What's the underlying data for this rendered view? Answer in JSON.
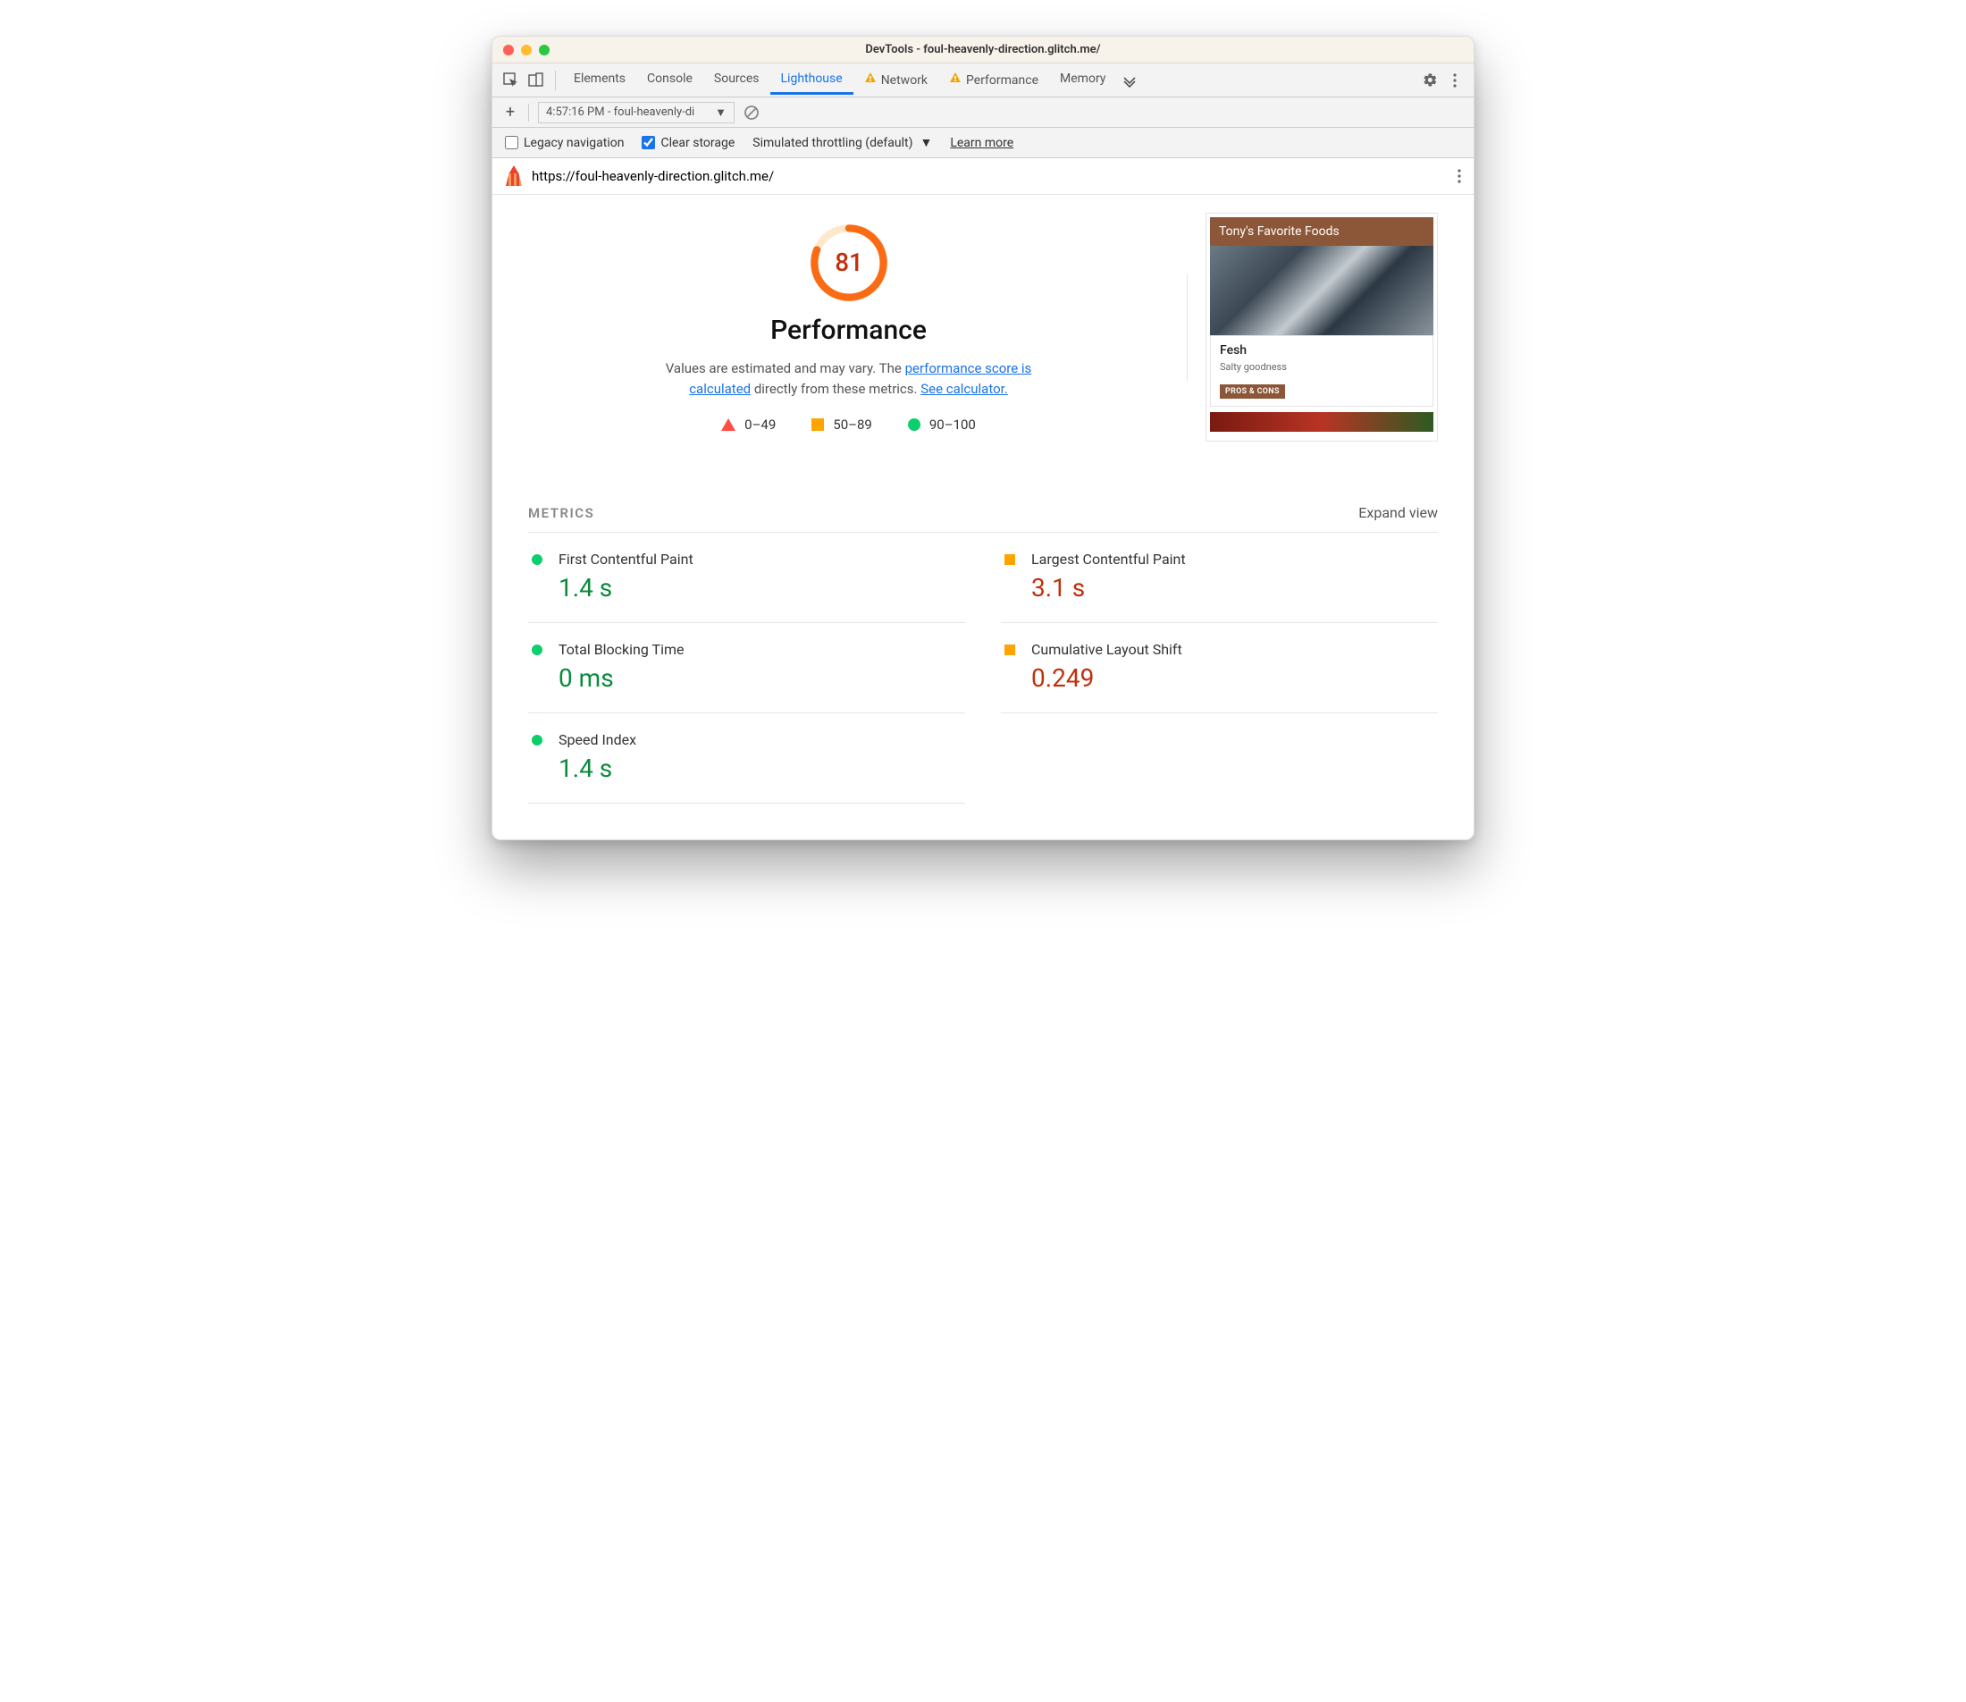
{
  "titlebar": {
    "title": "DevTools - foul-heavenly-direction.glitch.me/"
  },
  "tabs": {
    "items": [
      "Elements",
      "Console",
      "Sources",
      "Lighthouse",
      "Network",
      "Performance",
      "Memory"
    ],
    "active": "Lighthouse",
    "warn_tabs": [
      "Network",
      "Performance"
    ]
  },
  "subbar": {
    "report_label": "4:57:16 PM - foul-heavenly-di"
  },
  "options": {
    "legacy_label": "Legacy navigation",
    "legacy_checked": false,
    "clear_label": "Clear storage",
    "clear_checked": true,
    "throttle_label": "Simulated throttling (default)",
    "learn_more": "Learn more"
  },
  "urlrow": {
    "url": "https://foul-heavenly-direction.glitch.me/"
  },
  "score": {
    "value": "81",
    "percent": 81,
    "category": "Performance",
    "desc_pre": "Values are estimated and may vary. The ",
    "link1": "performance score is calculated",
    "desc_mid": " directly from these metrics. ",
    "link2": "See calculator."
  },
  "legend": {
    "bad": "0–49",
    "avg": "50–89",
    "good": "90–100"
  },
  "preview": {
    "header": "Tony's Favorite Foods",
    "card_title": "Fesh",
    "card_sub": "Salty goodness",
    "card_btn": "PROS & CONS"
  },
  "metrics": {
    "heading": "METRICS",
    "expand": "Expand view",
    "items": [
      {
        "label": "First Contentful Paint",
        "value": "1.4 s",
        "status": "good"
      },
      {
        "label": "Largest Contentful Paint",
        "value": "3.1 s",
        "status": "avg"
      },
      {
        "label": "Total Blocking Time",
        "value": "0 ms",
        "status": "good"
      },
      {
        "label": "Cumulative Layout Shift",
        "value": "0.249",
        "status": "avg"
      },
      {
        "label": "Speed Index",
        "value": "1.4 s",
        "status": "good"
      }
    ]
  }
}
